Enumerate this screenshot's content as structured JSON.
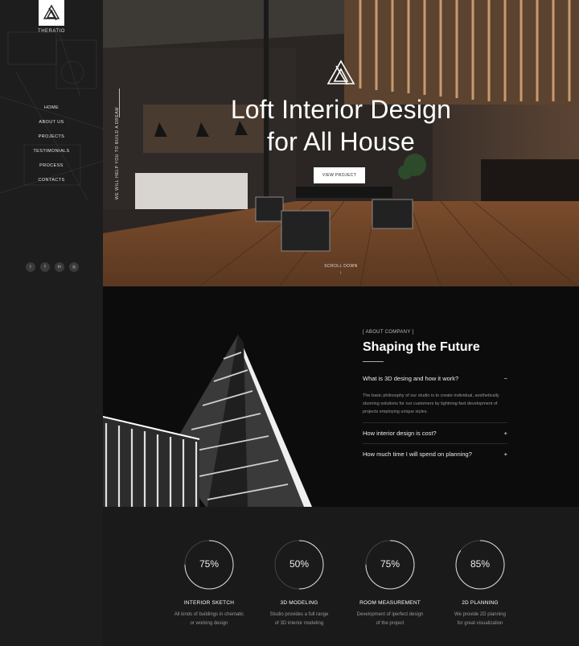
{
  "brand": {
    "name": "THERATIO"
  },
  "sidebar": {
    "nav": [
      "HOME",
      "ABOUT US",
      "PROJECTS",
      "TESTIMONIALS",
      "PROCESS",
      "CONTACTS"
    ],
    "tagline": "WE WILL HELP YOU TO BUILD A DREAM",
    "socials": [
      {
        "icon": "twitter-icon",
        "glyph": "t"
      },
      {
        "icon": "facebook-icon",
        "glyph": "f"
      },
      {
        "icon": "linkedin-icon",
        "glyph": "in"
      },
      {
        "icon": "instagram-icon",
        "glyph": "◎"
      }
    ]
  },
  "hero": {
    "title_line1": "Loft Interior Design",
    "title_line2": "for All House",
    "button": "VIEW PROJECT",
    "scroll": "SCROLL DOWN"
  },
  "about": {
    "tag": "[ ABOUT COMPANY ]",
    "title": "Shaping the Future",
    "faq": [
      {
        "q": "What is 3D desing and how it work?",
        "toggle": "−",
        "a": "The basic philosophy of our studio is to create individual, aesthetically stunning solutions for our customers by lightning-fast development of projects employing unique styles."
      },
      {
        "q": "How interior design is cost?",
        "toggle": "+",
        "a": ""
      },
      {
        "q": "How much time I will spend on planning?",
        "toggle": "+",
        "a": ""
      }
    ]
  },
  "skills": [
    {
      "value": 75,
      "label": "75%",
      "title": "INTERIOR SKETCH",
      "desc1": "All kinds of buildings in chematic",
      "desc2": "or working design"
    },
    {
      "value": 50,
      "label": "50%",
      "title": "3D MODELING",
      "desc1": "Studio provides a full range",
      "desc2": "of 3D interior modeling"
    },
    {
      "value": 75,
      "label": "75%",
      "title": "ROOM MEASUREMENT",
      "desc1": "Development of iperfect design",
      "desc2": "of the project"
    },
    {
      "value": 85,
      "label": "85%",
      "title": "2D PLANNING",
      "desc1": "We provide 2D planning",
      "desc2": "for great visualization"
    }
  ],
  "colors": {
    "sidebar": "#1d1d1d",
    "about_bg": "#0c0c0c",
    "skills_bg": "#1a1a1a",
    "wood": "#8a5a36"
  }
}
